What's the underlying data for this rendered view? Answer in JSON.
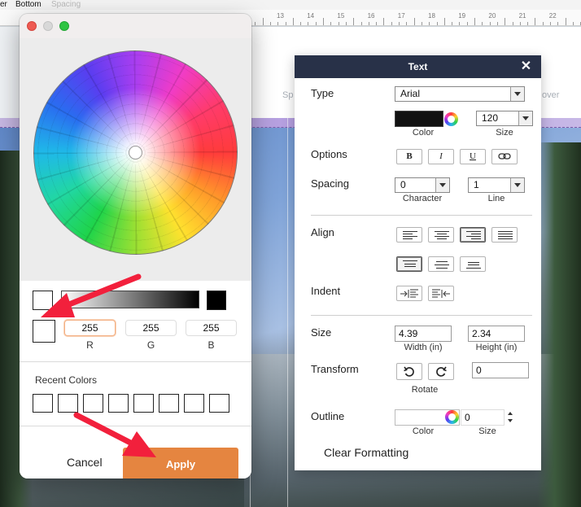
{
  "menubar": {
    "item_0": "er",
    "item_1": "Bottom",
    "item_2": "Spacing"
  },
  "ruler": {
    "numbers": [
      "13",
      "14",
      "15",
      "16",
      "17",
      "18",
      "19",
      "20",
      "21",
      "22"
    ]
  },
  "canvas": {
    "ghost_left": "Sp",
    "ghost_right": "over"
  },
  "color_picker": {
    "channels": [
      {
        "label": "R",
        "value": "255"
      },
      {
        "label": "G",
        "value": "255"
      },
      {
        "label": "B",
        "value": "255"
      }
    ],
    "recent_label": "Recent Colors",
    "cancel_label": "Cancel",
    "apply_label": "Apply",
    "apply_color": "#e58540"
  },
  "text_panel": {
    "title": "Text",
    "type_label": "Type",
    "font_value": "Arial",
    "color_caption": "Color",
    "size_value": "120",
    "size_caption": "Size",
    "options_label": "Options",
    "bold_glyph": "B",
    "italic_glyph": "I",
    "underline_glyph": "U",
    "spacing_label": "Spacing",
    "character_value": "0",
    "character_caption": "Character",
    "line_value": "1",
    "line_caption": "Line",
    "align_label": "Align",
    "indent_label": "Indent",
    "size_label": "Size",
    "width_value": "4.39",
    "width_caption": "Width (in)",
    "height_value": "2.34",
    "height_caption": "Height (in)",
    "transform_label": "Transform",
    "rotate_value": "0",
    "rotate_caption": "Rotate",
    "outline_label": "Outline",
    "outline_color_caption": "Color",
    "outline_size_value": "0",
    "outline_size_caption": "Size",
    "clear_label": "Clear Formatting",
    "header_color": "#283148"
  }
}
